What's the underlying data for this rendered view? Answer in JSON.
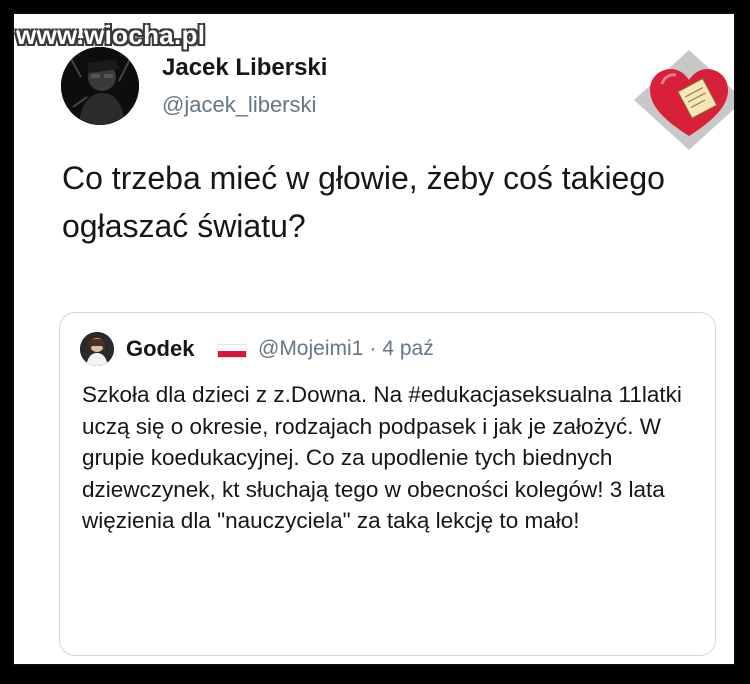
{
  "watermark": "www.wiocha.pl",
  "tweet": {
    "author_name": "Jacek Liberski",
    "author_handle": "@jacek_liberski",
    "text": "Co trzeba mieć w głowie, żeby coś takiego ogłaszać światu?"
  },
  "quoted_tweet": {
    "author_name": "Godek",
    "author_handle": "@Mojeimi1",
    "separator": "·",
    "date": "4 paź",
    "text": "Szkoła dla dzieci z z.Downa. Na #edukacjaseksualna 11latki uczą się o okresie, rodzajach podpasek i jak je założyć. W grupie koedukacyjnej. Co za upodlenie tych biednych dziewczynek, kt słuchają tego w obecności kolegów! 3 lata więzienia dla \"nauczyciela\" za taką lekcję to mało!"
  },
  "colors": {
    "flag_white": "#ffffff",
    "flag_red": "#dc143c",
    "handle_gray": "#657786",
    "text_dark": "#14171a",
    "heart_red": "#d8203a",
    "badge_bg": "#c8c8c8"
  },
  "icons": {
    "flag": "poland-flag-icon",
    "badge": "heart-badge-icon"
  }
}
